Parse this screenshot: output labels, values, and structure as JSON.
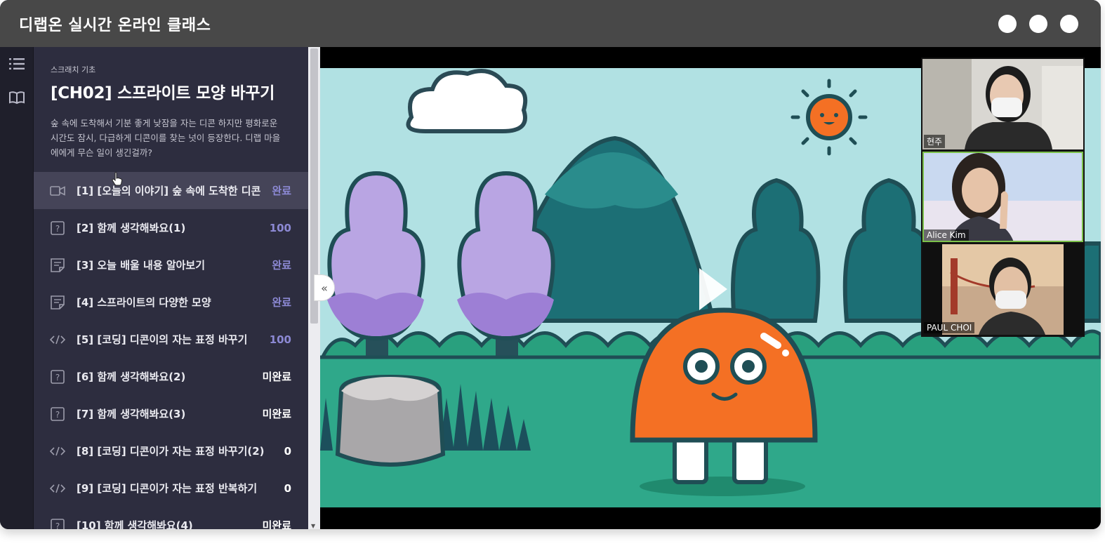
{
  "window": {
    "title": "디랩온 실시간 온라인 클래스"
  },
  "rail": {
    "items": [
      {
        "icon": "list-icon"
      },
      {
        "icon": "book-icon"
      }
    ]
  },
  "course": {
    "breadcrumb": "스크래치 기초",
    "chapter_title": "[CH02] 스프라이트 모양 바꾸기",
    "description": "숲 속에 도착해서 기분 좋게 낮잠을 자는 디콘 하지만 평화로운 시간도 잠시, 다급하게 디콘이를 찾는 넛이 등장한다. 디랩 마을에에게 무슨 일이 생긴걸까?"
  },
  "lessons": [
    {
      "icon": "video-icon",
      "title": "[1] [오늘의 이야기] 숲 속에 도착한 디콘",
      "status": "완료",
      "state": "done"
    },
    {
      "icon": "quiz-icon",
      "title": "[2] 함께 생각해봐요(1)",
      "status": "100",
      "state": "done"
    },
    {
      "icon": "note-icon",
      "title": "[3] 오늘 배울 내용 알아보기",
      "status": "완료",
      "state": "done"
    },
    {
      "icon": "note-icon",
      "title": "[4] 스프라이트의 다양한 모양",
      "status": "완료",
      "state": "done"
    },
    {
      "icon": "code-icon",
      "title": "[5] [코딩] 디콘이의 자는 표정 바꾸기",
      "status": "100",
      "state": "done"
    },
    {
      "icon": "quiz-icon",
      "title": "[6] 함께 생각해봐요(2)",
      "status": "미완료",
      "state": "todo"
    },
    {
      "icon": "quiz-icon",
      "title": "[7] 함께 생각해봐요(3)",
      "status": "미완료",
      "state": "todo"
    },
    {
      "icon": "code-icon",
      "title": "[8] [코딩] 디콘이가 자는 표정 바꾸기(2)",
      "status": "0",
      "state": "todo"
    },
    {
      "icon": "code-icon",
      "title": "[9] [코딩] 디콘이가 자는 표정 반복하기",
      "status": "0",
      "state": "todo"
    },
    {
      "icon": "quiz-icon",
      "title": "[10] 함께 생각해봐요(4)",
      "status": "미완료",
      "state": "todo"
    }
  ],
  "video": {
    "play_icon": "play-icon",
    "collapse_icon": "double-chevron-left-icon",
    "collapse_glyph": "«"
  },
  "participants": [
    {
      "name": "현주",
      "speaking": false
    },
    {
      "name": "Alice Kim",
      "speaking": true
    },
    {
      "name": "PAUL CHOI",
      "speaking": false
    }
  ],
  "colors": {
    "titlebar": "#484848",
    "panel": "#2d2d3f",
    "active_row": "#454458",
    "status_done": "#8c89d4",
    "sky": "#b1e1e3",
    "ground": "#2fa88a",
    "dicon_orange": "#f47024"
  }
}
